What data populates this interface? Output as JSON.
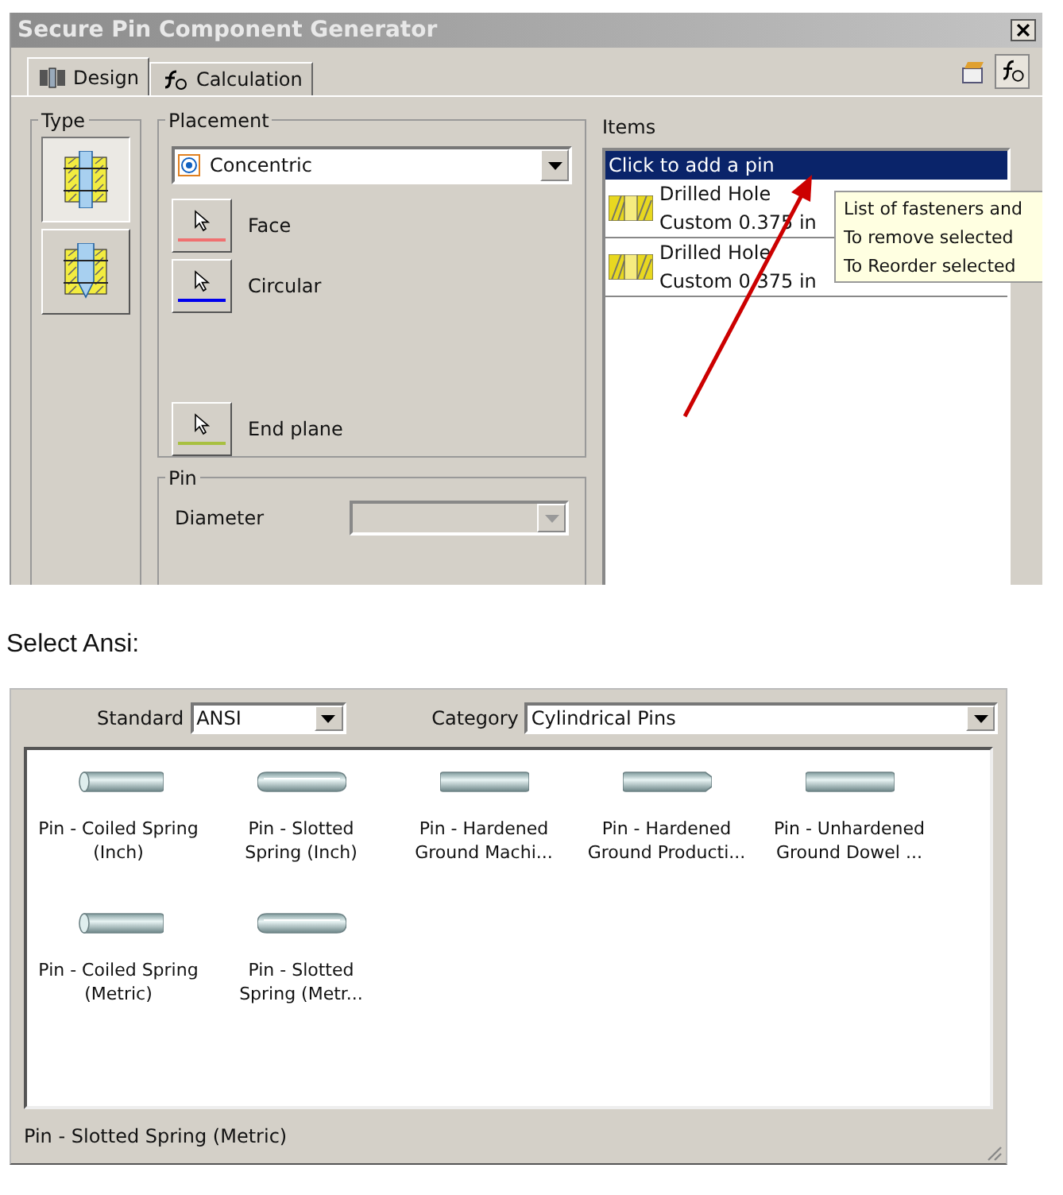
{
  "top_dialog": {
    "title": "Secure Pin Component Generator",
    "tabs": [
      {
        "label": "Design",
        "selected": true
      },
      {
        "label": "Calculation",
        "selected": false
      }
    ],
    "type_group": {
      "label": "Type",
      "options": [
        {
          "kind": "through",
          "selected": true
        },
        {
          "kind": "blind",
          "selected": false
        }
      ]
    },
    "placement": {
      "label": "Placement",
      "dropdown": "Concentric",
      "selectors": [
        {
          "label": "Face",
          "color": "#f07070"
        },
        {
          "label": "Circular",
          "color": "#0000ee"
        },
        {
          "label": "End plane",
          "color": "#a8c040"
        }
      ]
    },
    "pin_group": {
      "label": "Pin",
      "diameter_label": "Diameter",
      "diameter_disabled": true
    },
    "items": {
      "label": "Items",
      "rows": [
        {
          "title": "Click to add a pin",
          "selected": true
        },
        {
          "title": "Drilled Hole",
          "subtitle": "Custom 0.375 in",
          "selected": false
        },
        {
          "title": "Drilled Hole",
          "subtitle": "Custom 0.375 in",
          "selected": false
        }
      ]
    },
    "tooltip": [
      "List of fasteners and",
      "To remove selected",
      "To Reorder selected"
    ]
  },
  "caption": "Select Ansi:",
  "bottom_dialog": {
    "standard_label": "Standard",
    "standard": "ANSI",
    "category_label": "Category",
    "category": "Cylindrical Pins",
    "pins": [
      {
        "kind": "coiled",
        "lines": [
          "Pin - Coiled Spring",
          "(Inch)"
        ]
      },
      {
        "kind": "slotted",
        "lines": [
          "Pin - Slotted",
          "Spring (Inch)"
        ]
      },
      {
        "kind": "solid",
        "lines": [
          "Pin - Hardened",
          "Ground Machi..."
        ]
      },
      {
        "kind": "chamfered",
        "lines": [
          "Pin - Hardened",
          "Ground Producti..."
        ]
      },
      {
        "kind": "solid",
        "lines": [
          "Pin - Unhardened",
          "Ground Dowel ..."
        ]
      },
      {
        "kind": "coiled",
        "lines": [
          "Pin - Coiled Spring",
          "(Metric)"
        ]
      },
      {
        "kind": "slotted",
        "lines": [
          "Pin - Slotted",
          "Spring (Metr..."
        ]
      }
    ],
    "status": "Pin - Slotted Spring (Metric)"
  }
}
